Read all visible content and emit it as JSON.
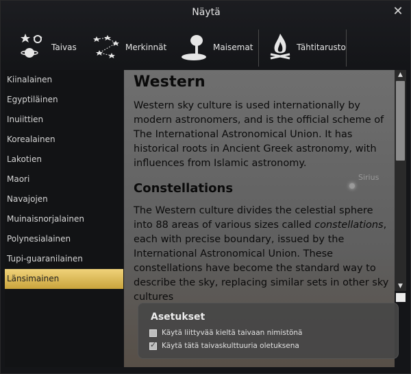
{
  "window": {
    "title": "Näytä",
    "close_glyph": "✕"
  },
  "toolbar": {
    "items": [
      {
        "label": "Taivas",
        "icon": "sky-icon"
      },
      {
        "label": "Merkinnät",
        "icon": "markings-icon"
      },
      {
        "label": "Maisemat",
        "icon": "landscape-icon"
      },
      {
        "label": "Tähtitarusto",
        "icon": "starlore-icon"
      }
    ]
  },
  "cultures": {
    "items": [
      {
        "label": "Kiinalainen"
      },
      {
        "label": "Egyptiläinen"
      },
      {
        "label": "Inuiittien"
      },
      {
        "label": "Korealainen"
      },
      {
        "label": "Lakotien"
      },
      {
        "label": "Maori"
      },
      {
        "label": "Navajojen"
      },
      {
        "label": "Muinaisnorjalainen"
      },
      {
        "label": "Polynesialainen"
      },
      {
        "label": "Tupi-guaranilainen"
      },
      {
        "label": "Länsimainen"
      }
    ],
    "selected_label": "Länsimainen"
  },
  "description": {
    "title": "Western",
    "intro": "Western sky culture is used internationally by modern astronomers, and is the official scheme of The International Astronomical Union. It has historical roots in Ancient Greek astronomy, with influences from Islamic astronomy.",
    "section_title": "Constellations",
    "body_before": "The Western culture divides the celestial sphere into 88 areas of various sizes called ",
    "body_em": "constellations",
    "body_after": ", each with precise boundary, issued by the International Astronomical Union. These constellations have become the standard way to describe the sky, replacing similar sets in other sky cultures",
    "sky_label": "Sirius"
  },
  "settings": {
    "title": "Asetukset",
    "option1": {
      "label": "Käytä liittyvää kieltä taivaan nimistönä",
      "checked": false
    },
    "option2": {
      "label": "Käytä tätä taivaskulttuuria oletuksena",
      "checked": true,
      "mark": "✓"
    }
  },
  "scrollbar": {
    "up_glyph": "▲",
    "down_glyph": "▼"
  }
}
